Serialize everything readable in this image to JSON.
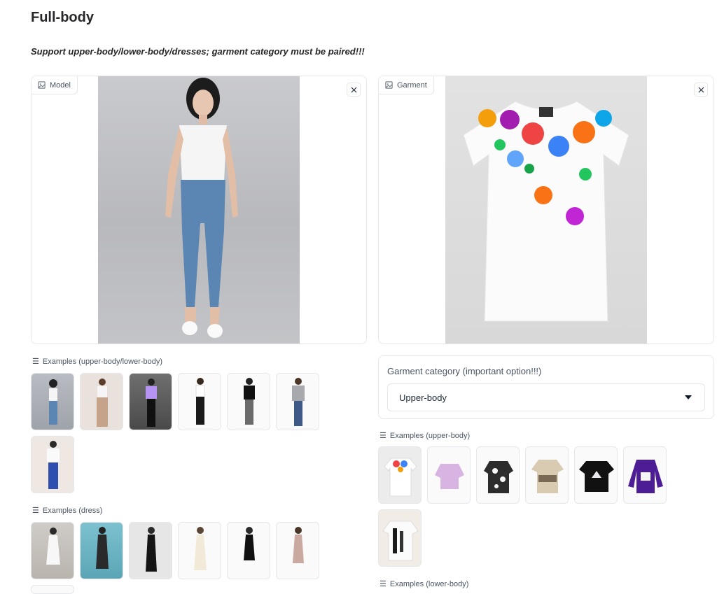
{
  "page": {
    "title": "Full-body",
    "subtitle": "Support upper-body/lower-body/dresses; garment category must be paired!!!"
  },
  "model_panel": {
    "label": "Model",
    "icon": "image-icon"
  },
  "garment_panel": {
    "label": "Garment",
    "icon": "image-icon"
  },
  "examples_upper_lower": {
    "label": "Examples (upper-body/lower-body)",
    "items": [
      "model-1",
      "model-2",
      "model-3",
      "model-4",
      "model-5",
      "model-6",
      "model-7"
    ]
  },
  "examples_dress": {
    "label": "Examples (dress)",
    "items": [
      "dress-1",
      "dress-2",
      "dress-3",
      "dress-4",
      "dress-5",
      "dress-6",
      "dress-7"
    ]
  },
  "garment_category": {
    "label": "Garment category (important option!!!)",
    "selected": "Upper-body"
  },
  "examples_upper_body": {
    "label": "Examples (upper-body)",
    "items": [
      "garment-1",
      "garment-2",
      "garment-3",
      "garment-4",
      "garment-5",
      "garment-6",
      "garment-7"
    ]
  },
  "examples_lower_body": {
    "label": "Examples (lower-body)"
  }
}
